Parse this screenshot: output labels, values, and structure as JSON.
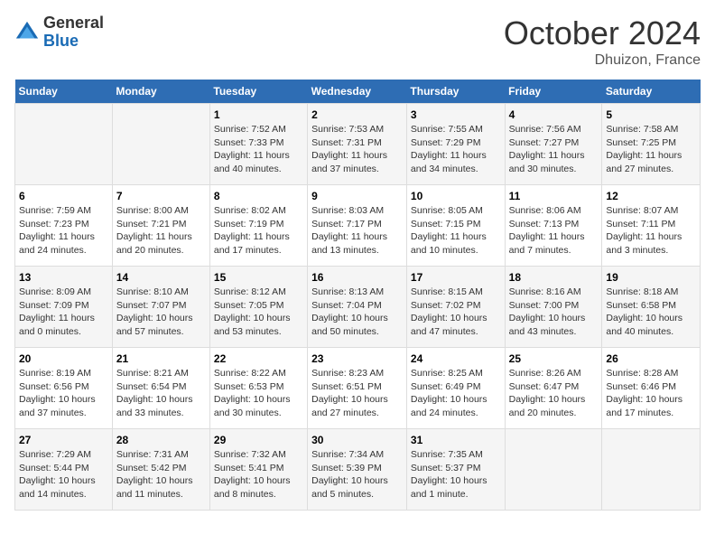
{
  "header": {
    "logo_general": "General",
    "logo_blue": "Blue",
    "month_title": "October 2024",
    "location": "Dhuizon, France"
  },
  "days_of_week": [
    "Sunday",
    "Monday",
    "Tuesday",
    "Wednesday",
    "Thursday",
    "Friday",
    "Saturday"
  ],
  "weeks": [
    [
      {
        "day": null
      },
      {
        "day": null
      },
      {
        "day": "1",
        "sunrise": "Sunrise: 7:52 AM",
        "sunset": "Sunset: 7:33 PM",
        "daylight": "Daylight: 11 hours and 40 minutes."
      },
      {
        "day": "2",
        "sunrise": "Sunrise: 7:53 AM",
        "sunset": "Sunset: 7:31 PM",
        "daylight": "Daylight: 11 hours and 37 minutes."
      },
      {
        "day": "3",
        "sunrise": "Sunrise: 7:55 AM",
        "sunset": "Sunset: 7:29 PM",
        "daylight": "Daylight: 11 hours and 34 minutes."
      },
      {
        "day": "4",
        "sunrise": "Sunrise: 7:56 AM",
        "sunset": "Sunset: 7:27 PM",
        "daylight": "Daylight: 11 hours and 30 minutes."
      },
      {
        "day": "5",
        "sunrise": "Sunrise: 7:58 AM",
        "sunset": "Sunset: 7:25 PM",
        "daylight": "Daylight: 11 hours and 27 minutes."
      }
    ],
    [
      {
        "day": "6",
        "sunrise": "Sunrise: 7:59 AM",
        "sunset": "Sunset: 7:23 PM",
        "daylight": "Daylight: 11 hours and 24 minutes."
      },
      {
        "day": "7",
        "sunrise": "Sunrise: 8:00 AM",
        "sunset": "Sunset: 7:21 PM",
        "daylight": "Daylight: 11 hours and 20 minutes."
      },
      {
        "day": "8",
        "sunrise": "Sunrise: 8:02 AM",
        "sunset": "Sunset: 7:19 PM",
        "daylight": "Daylight: 11 hours and 17 minutes."
      },
      {
        "day": "9",
        "sunrise": "Sunrise: 8:03 AM",
        "sunset": "Sunset: 7:17 PM",
        "daylight": "Daylight: 11 hours and 13 minutes."
      },
      {
        "day": "10",
        "sunrise": "Sunrise: 8:05 AM",
        "sunset": "Sunset: 7:15 PM",
        "daylight": "Daylight: 11 hours and 10 minutes."
      },
      {
        "day": "11",
        "sunrise": "Sunrise: 8:06 AM",
        "sunset": "Sunset: 7:13 PM",
        "daylight": "Daylight: 11 hours and 7 minutes."
      },
      {
        "day": "12",
        "sunrise": "Sunrise: 8:07 AM",
        "sunset": "Sunset: 7:11 PM",
        "daylight": "Daylight: 11 hours and 3 minutes."
      }
    ],
    [
      {
        "day": "13",
        "sunrise": "Sunrise: 8:09 AM",
        "sunset": "Sunset: 7:09 PM",
        "daylight": "Daylight: 11 hours and 0 minutes."
      },
      {
        "day": "14",
        "sunrise": "Sunrise: 8:10 AM",
        "sunset": "Sunset: 7:07 PM",
        "daylight": "Daylight: 10 hours and 57 minutes."
      },
      {
        "day": "15",
        "sunrise": "Sunrise: 8:12 AM",
        "sunset": "Sunset: 7:05 PM",
        "daylight": "Daylight: 10 hours and 53 minutes."
      },
      {
        "day": "16",
        "sunrise": "Sunrise: 8:13 AM",
        "sunset": "Sunset: 7:04 PM",
        "daylight": "Daylight: 10 hours and 50 minutes."
      },
      {
        "day": "17",
        "sunrise": "Sunrise: 8:15 AM",
        "sunset": "Sunset: 7:02 PM",
        "daylight": "Daylight: 10 hours and 47 minutes."
      },
      {
        "day": "18",
        "sunrise": "Sunrise: 8:16 AM",
        "sunset": "Sunset: 7:00 PM",
        "daylight": "Daylight: 10 hours and 43 minutes."
      },
      {
        "day": "19",
        "sunrise": "Sunrise: 8:18 AM",
        "sunset": "Sunset: 6:58 PM",
        "daylight": "Daylight: 10 hours and 40 minutes."
      }
    ],
    [
      {
        "day": "20",
        "sunrise": "Sunrise: 8:19 AM",
        "sunset": "Sunset: 6:56 PM",
        "daylight": "Daylight: 10 hours and 37 minutes."
      },
      {
        "day": "21",
        "sunrise": "Sunrise: 8:21 AM",
        "sunset": "Sunset: 6:54 PM",
        "daylight": "Daylight: 10 hours and 33 minutes."
      },
      {
        "day": "22",
        "sunrise": "Sunrise: 8:22 AM",
        "sunset": "Sunset: 6:53 PM",
        "daylight": "Daylight: 10 hours and 30 minutes."
      },
      {
        "day": "23",
        "sunrise": "Sunrise: 8:23 AM",
        "sunset": "Sunset: 6:51 PM",
        "daylight": "Daylight: 10 hours and 27 minutes."
      },
      {
        "day": "24",
        "sunrise": "Sunrise: 8:25 AM",
        "sunset": "Sunset: 6:49 PM",
        "daylight": "Daylight: 10 hours and 24 minutes."
      },
      {
        "day": "25",
        "sunrise": "Sunrise: 8:26 AM",
        "sunset": "Sunset: 6:47 PM",
        "daylight": "Daylight: 10 hours and 20 minutes."
      },
      {
        "day": "26",
        "sunrise": "Sunrise: 8:28 AM",
        "sunset": "Sunset: 6:46 PM",
        "daylight": "Daylight: 10 hours and 17 minutes."
      }
    ],
    [
      {
        "day": "27",
        "sunrise": "Sunrise: 7:29 AM",
        "sunset": "Sunset: 5:44 PM",
        "daylight": "Daylight: 10 hours and 14 minutes."
      },
      {
        "day": "28",
        "sunrise": "Sunrise: 7:31 AM",
        "sunset": "Sunset: 5:42 PM",
        "daylight": "Daylight: 10 hours and 11 minutes."
      },
      {
        "day": "29",
        "sunrise": "Sunrise: 7:32 AM",
        "sunset": "Sunset: 5:41 PM",
        "daylight": "Daylight: 10 hours and 8 minutes."
      },
      {
        "day": "30",
        "sunrise": "Sunrise: 7:34 AM",
        "sunset": "Sunset: 5:39 PM",
        "daylight": "Daylight: 10 hours and 5 minutes."
      },
      {
        "day": "31",
        "sunrise": "Sunrise: 7:35 AM",
        "sunset": "Sunset: 5:37 PM",
        "daylight": "Daylight: 10 hours and 1 minute."
      },
      {
        "day": null
      },
      {
        "day": null
      }
    ]
  ]
}
